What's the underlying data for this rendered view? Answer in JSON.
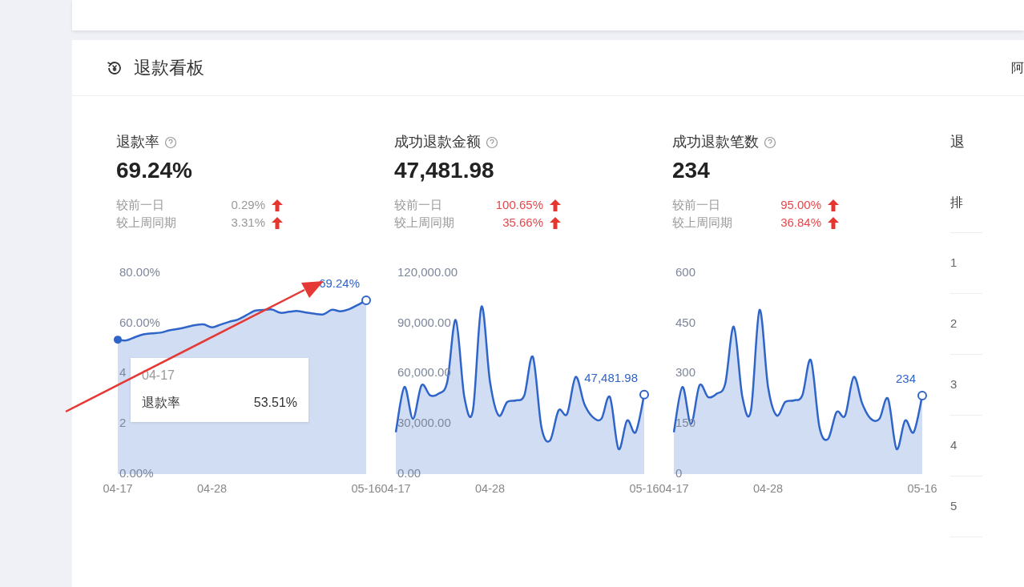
{
  "panel": {
    "title": "退款看板",
    "right_text": "阿"
  },
  "metrics": [
    {
      "title": "退款率",
      "value": "69.24%",
      "comparisons": [
        {
          "label": "较前一日",
          "value": "0.29%",
          "emphasis": false
        },
        {
          "label": "较上周同期",
          "value": "3.31%",
          "emphasis": false
        }
      ],
      "tooltip": {
        "date": "04-17",
        "label": "退款率",
        "value": "53.51%"
      },
      "covered_axis_labels": [
        "4",
        "2"
      ],
      "chart_data": {
        "type": "area",
        "categories": [
          "04-17",
          null,
          null,
          null,
          null,
          null,
          null,
          null,
          null,
          null,
          null,
          "04-28",
          null,
          null,
          null,
          null,
          null,
          null,
          null,
          null,
          null,
          null,
          null,
          null,
          null,
          null,
          null,
          null,
          null,
          "05-16"
        ],
        "ylim": [
          0,
          80
        ],
        "yticks": [
          {
            "value": 0,
            "label": "0.00%"
          },
          {
            "value": 60,
            "label": "60.00%"
          },
          {
            "value": 80,
            "label": "80.00%"
          }
        ],
        "series": [
          {
            "color": "#2f64c9",
            "values": [
              53.5,
              53.2,
              54.5,
              55.6,
              56,
              56.3,
              57.2,
              57.8,
              58.5,
              59.3,
              59.6,
              58.4,
              59.5,
              60.6,
              61.5,
              63.2,
              65,
              65.3,
              65.5,
              64.2,
              64.6,
              64.9,
              64.3,
              63.8,
              63.6,
              65.4,
              64.8,
              65.6,
              67.3,
              69.2
            ]
          }
        ],
        "annotations": [
          {
            "x": "05-16",
            "y": 69.2,
            "text": "69.24%"
          }
        ]
      }
    },
    {
      "title": "成功退款金额",
      "value": "47,481.98",
      "comparisons": [
        {
          "label": "较前一日",
          "value": "100.65%",
          "emphasis": true
        },
        {
          "label": "较上周同期",
          "value": "35.66%",
          "emphasis": true
        }
      ],
      "chart_data": {
        "type": "area",
        "categories": [
          "04-17",
          null,
          null,
          null,
          null,
          null,
          null,
          null,
          null,
          null,
          null,
          "04-28",
          null,
          null,
          null,
          null,
          null,
          null,
          null,
          null,
          null,
          null,
          null,
          null,
          null,
          null,
          null,
          null,
          null,
          "05-16"
        ],
        "ylim": [
          0,
          120000
        ],
        "yticks": [
          {
            "value": 0,
            "label": "0.00"
          },
          {
            "value": 30000,
            "label": "30,000.00"
          },
          {
            "value": 60000,
            "label": "60,000.00"
          },
          {
            "value": 90000,
            "label": "90,000.00"
          },
          {
            "value": 120000,
            "label": "120,000.00"
          }
        ],
        "series": [
          {
            "color": "#2f64c9",
            "values": [
              25000,
              52000,
              33000,
              53000,
              47000,
              48000,
              55000,
              92000,
              46000,
              38000,
              100000,
              55000,
              35000,
              43000,
              44000,
              47000,
              70000,
              28000,
              20000,
              38000,
              36000,
              58000,
              42000,
              34000,
              33000,
              46000,
              15000,
              32000,
              25000,
              47500
            ]
          }
        ],
        "annotations": [
          {
            "x": "05-16",
            "y": 47500,
            "text": "47,481.98"
          }
        ]
      }
    },
    {
      "title": "成功退款笔数",
      "value": "234",
      "comparisons": [
        {
          "label": "较前一日",
          "value": "95.00%",
          "emphasis": true
        },
        {
          "label": "较上周同期",
          "value": "36.84%",
          "emphasis": true
        }
      ],
      "chart_data": {
        "type": "area",
        "categories": [
          "04-17",
          null,
          null,
          null,
          null,
          null,
          null,
          null,
          null,
          null,
          null,
          "04-28",
          null,
          null,
          null,
          null,
          null,
          null,
          null,
          null,
          null,
          null,
          null,
          null,
          null,
          null,
          null,
          null,
          null,
          "05-16"
        ],
        "ylim": [
          0,
          600
        ],
        "yticks": [
          {
            "value": 0,
            "label": "0"
          },
          {
            "value": 150,
            "label": "150"
          },
          {
            "value": 300,
            "label": "300"
          },
          {
            "value": 450,
            "label": "450"
          },
          {
            "value": 600,
            "label": "600"
          }
        ],
        "series": [
          {
            "color": "#2f64c9",
            "values": [
              125,
              260,
              150,
              265,
              230,
              240,
              270,
              440,
              230,
              190,
              490,
              260,
              175,
              215,
              220,
              235,
              340,
              140,
              105,
              185,
              175,
              290,
              210,
              165,
              165,
              225,
              75,
              160,
              125,
              234
            ]
          }
        ],
        "annotations": [
          {
            "x": "05-16",
            "y": 234,
            "text": "234"
          }
        ]
      }
    }
  ],
  "cut_column": {
    "title": "退",
    "header": "排",
    "rows": [
      "1",
      "2",
      "3",
      "4",
      "5"
    ]
  }
}
